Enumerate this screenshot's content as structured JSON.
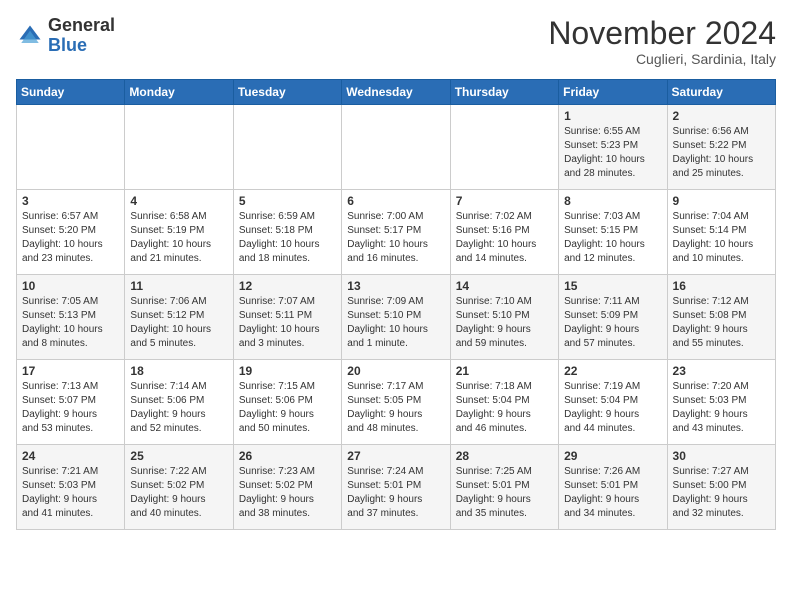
{
  "header": {
    "logo": {
      "general": "General",
      "blue": "Blue"
    },
    "title": "November 2024",
    "location": "Cuglieri, Sardinia, Italy"
  },
  "calendar": {
    "weekdays": [
      "Sunday",
      "Monday",
      "Tuesday",
      "Wednesday",
      "Thursday",
      "Friday",
      "Saturday"
    ],
    "weeks": [
      [
        {
          "day": "",
          "info": ""
        },
        {
          "day": "",
          "info": ""
        },
        {
          "day": "",
          "info": ""
        },
        {
          "day": "",
          "info": ""
        },
        {
          "day": "",
          "info": ""
        },
        {
          "day": "1",
          "info": "Sunrise: 6:55 AM\nSunset: 5:23 PM\nDaylight: 10 hours\nand 28 minutes."
        },
        {
          "day": "2",
          "info": "Sunrise: 6:56 AM\nSunset: 5:22 PM\nDaylight: 10 hours\nand 25 minutes."
        }
      ],
      [
        {
          "day": "3",
          "info": "Sunrise: 6:57 AM\nSunset: 5:20 PM\nDaylight: 10 hours\nand 23 minutes."
        },
        {
          "day": "4",
          "info": "Sunrise: 6:58 AM\nSunset: 5:19 PM\nDaylight: 10 hours\nand 21 minutes."
        },
        {
          "day": "5",
          "info": "Sunrise: 6:59 AM\nSunset: 5:18 PM\nDaylight: 10 hours\nand 18 minutes."
        },
        {
          "day": "6",
          "info": "Sunrise: 7:00 AM\nSunset: 5:17 PM\nDaylight: 10 hours\nand 16 minutes."
        },
        {
          "day": "7",
          "info": "Sunrise: 7:02 AM\nSunset: 5:16 PM\nDaylight: 10 hours\nand 14 minutes."
        },
        {
          "day": "8",
          "info": "Sunrise: 7:03 AM\nSunset: 5:15 PM\nDaylight: 10 hours\nand 12 minutes."
        },
        {
          "day": "9",
          "info": "Sunrise: 7:04 AM\nSunset: 5:14 PM\nDaylight: 10 hours\nand 10 minutes."
        }
      ],
      [
        {
          "day": "10",
          "info": "Sunrise: 7:05 AM\nSunset: 5:13 PM\nDaylight: 10 hours\nand 8 minutes."
        },
        {
          "day": "11",
          "info": "Sunrise: 7:06 AM\nSunset: 5:12 PM\nDaylight: 10 hours\nand 5 minutes."
        },
        {
          "day": "12",
          "info": "Sunrise: 7:07 AM\nSunset: 5:11 PM\nDaylight: 10 hours\nand 3 minutes."
        },
        {
          "day": "13",
          "info": "Sunrise: 7:09 AM\nSunset: 5:10 PM\nDaylight: 10 hours\nand 1 minute."
        },
        {
          "day": "14",
          "info": "Sunrise: 7:10 AM\nSunset: 5:10 PM\nDaylight: 9 hours\nand 59 minutes."
        },
        {
          "day": "15",
          "info": "Sunrise: 7:11 AM\nSunset: 5:09 PM\nDaylight: 9 hours\nand 57 minutes."
        },
        {
          "day": "16",
          "info": "Sunrise: 7:12 AM\nSunset: 5:08 PM\nDaylight: 9 hours\nand 55 minutes."
        }
      ],
      [
        {
          "day": "17",
          "info": "Sunrise: 7:13 AM\nSunset: 5:07 PM\nDaylight: 9 hours\nand 53 minutes."
        },
        {
          "day": "18",
          "info": "Sunrise: 7:14 AM\nSunset: 5:06 PM\nDaylight: 9 hours\nand 52 minutes."
        },
        {
          "day": "19",
          "info": "Sunrise: 7:15 AM\nSunset: 5:06 PM\nDaylight: 9 hours\nand 50 minutes."
        },
        {
          "day": "20",
          "info": "Sunrise: 7:17 AM\nSunset: 5:05 PM\nDaylight: 9 hours\nand 48 minutes."
        },
        {
          "day": "21",
          "info": "Sunrise: 7:18 AM\nSunset: 5:04 PM\nDaylight: 9 hours\nand 46 minutes."
        },
        {
          "day": "22",
          "info": "Sunrise: 7:19 AM\nSunset: 5:04 PM\nDaylight: 9 hours\nand 44 minutes."
        },
        {
          "day": "23",
          "info": "Sunrise: 7:20 AM\nSunset: 5:03 PM\nDaylight: 9 hours\nand 43 minutes."
        }
      ],
      [
        {
          "day": "24",
          "info": "Sunrise: 7:21 AM\nSunset: 5:03 PM\nDaylight: 9 hours\nand 41 minutes."
        },
        {
          "day": "25",
          "info": "Sunrise: 7:22 AM\nSunset: 5:02 PM\nDaylight: 9 hours\nand 40 minutes."
        },
        {
          "day": "26",
          "info": "Sunrise: 7:23 AM\nSunset: 5:02 PM\nDaylight: 9 hours\nand 38 minutes."
        },
        {
          "day": "27",
          "info": "Sunrise: 7:24 AM\nSunset: 5:01 PM\nDaylight: 9 hours\nand 37 minutes."
        },
        {
          "day": "28",
          "info": "Sunrise: 7:25 AM\nSunset: 5:01 PM\nDaylight: 9 hours\nand 35 minutes."
        },
        {
          "day": "29",
          "info": "Sunrise: 7:26 AM\nSunset: 5:01 PM\nDaylight: 9 hours\nand 34 minutes."
        },
        {
          "day": "30",
          "info": "Sunrise: 7:27 AM\nSunset: 5:00 PM\nDaylight: 9 hours\nand 32 minutes."
        }
      ]
    ]
  }
}
